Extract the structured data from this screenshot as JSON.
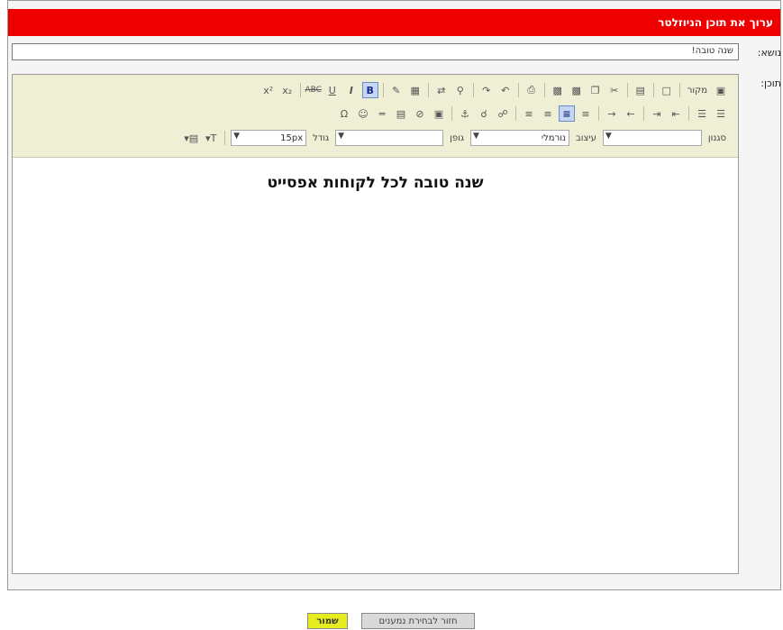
{
  "window": {
    "title": "ערוך את תוכן הניוזלטר"
  },
  "form": {
    "subject_label": "נושא:",
    "subject_value": "שנה טובה!",
    "content_label": "תוכן:"
  },
  "toolbar": {
    "row1_icons": [
      "template-icon",
      "new-doc-icon",
      "paste-word-icon",
      "separator",
      "cut-icon",
      "copy-icon",
      "paste-icon",
      "paste-text-icon",
      "print-icon",
      "separator",
      "undo-icon",
      "redo-icon",
      "separator",
      "find-icon",
      "replace-icon",
      "separator",
      "eraser-icon",
      "bold-icon",
      "italic-icon",
      "underline-icon",
      "strikethrough-icon",
      "separator",
      "subscript-icon",
      "superscript-icon"
    ],
    "source_label": "מקור",
    "size_label": "גודל",
    "size_value": "15px",
    "font_label": "גופן",
    "format_label": "עיצוב",
    "format_value": "נורמלי",
    "style_label": "סגנון"
  },
  "editor": {
    "content_text": "שנה טובה לכל לקוחות אפסייט"
  },
  "buttons": {
    "save_label": "שמור",
    "back_label": "חזור לבחירת נמענים"
  },
  "colors": {
    "titlebar": "#ee0000",
    "toolbar_bg": "#efefd6",
    "save_button": "#e6ec1e"
  }
}
